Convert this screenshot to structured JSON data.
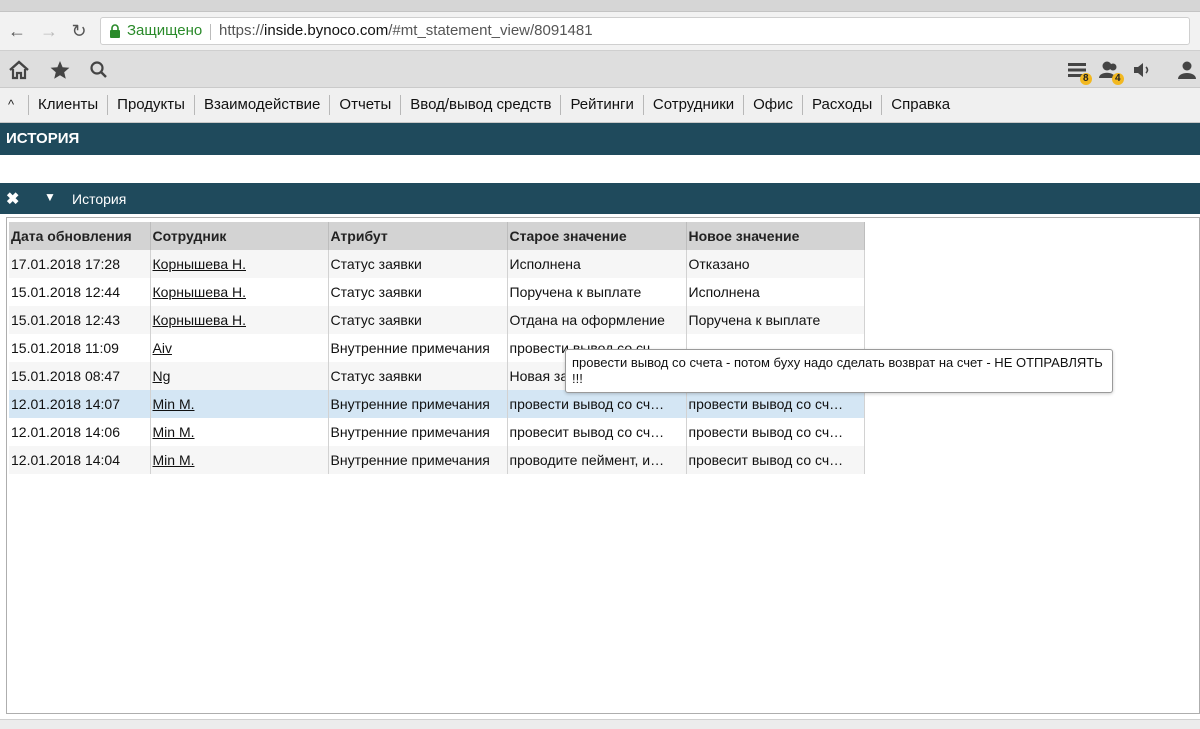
{
  "browser": {
    "secure_label": "Защищено",
    "url_scheme": "https://",
    "url_host": "inside.bynoco.com",
    "url_path": "/#mt_statement_view/8091481"
  },
  "toolbar": {
    "badge_tasks": "8",
    "badge_users": "4"
  },
  "menu": {
    "items": [
      "Клиенты",
      "Продукты",
      "Взаимодействие",
      "Отчеты",
      "Ввод/вывод средств",
      "Рейтинги",
      "Сотрудники",
      "Офис",
      "Расходы",
      "Справка"
    ]
  },
  "section": {
    "title": "ИСТОРИЯ"
  },
  "panel": {
    "title": "История"
  },
  "table": {
    "headers": [
      "Дата обновления",
      "Сотрудник",
      "Атрибут",
      "Старое значение",
      "Новое значение"
    ],
    "rows": [
      {
        "date": "17.01.2018 17:28",
        "employee": "Корнышева Н.",
        "attribute": "Статус заявки",
        "old": "Исполнена",
        "new": "Отказано"
      },
      {
        "date": "15.01.2018 12:44",
        "employee": "Корнышева Н.",
        "attribute": "Статус заявки",
        "old": "Поручена к выплате",
        "new": "Исполнена"
      },
      {
        "date": "15.01.2018 12:43",
        "employee": "Корнышева Н.",
        "attribute": "Статус заявки",
        "old": "Отдана на оформление",
        "new": "Поручена к выплате"
      },
      {
        "date": "15.01.2018 11:09",
        "employee": "Aiv",
        "attribute": "Внутренние примечания",
        "old": "провести вывод со сч",
        "new": ""
      },
      {
        "date": "15.01.2018 08:47",
        "employee": "Ng",
        "attribute": "Статус заявки",
        "old": "Новая за",
        "new": ""
      },
      {
        "date": "12.01.2018 14:07",
        "employee": "Min M.",
        "attribute": "Внутренние примечания",
        "old": "провести вывод со сч…",
        "new": "провести вывод со сч…"
      },
      {
        "date": "12.01.2018 14:06",
        "employee": "Min M.",
        "attribute": "Внутренние примечания",
        "old": "провесит вывод со сч…",
        "new": "провести вывод со сч…"
      },
      {
        "date": "12.01.2018 14:04",
        "employee": "Min M.",
        "attribute": "Внутренние примечания",
        "old": "проводите пеймент, и…",
        "new": "провесит вывод со сч…"
      }
    ]
  },
  "tooltip": {
    "text": "провести вывод со счета - потом буху надо сделать возврат на счет - НЕ ОТПРАВЛЯТЬ !!!"
  }
}
